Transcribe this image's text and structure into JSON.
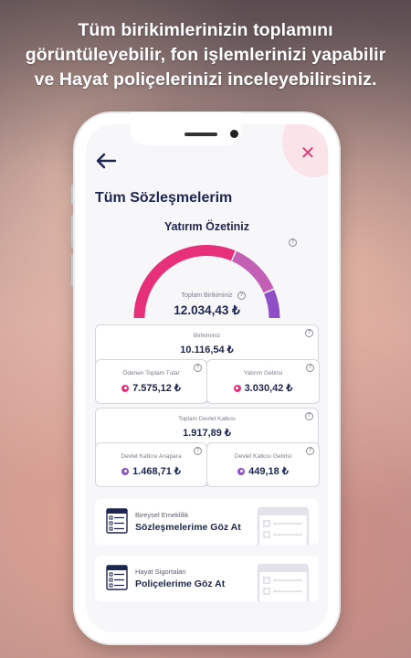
{
  "headline": {
    "line1": "Tüm birikimlerinizin toplamını",
    "line2": "görüntüleyebilir, fon işlemlerinizi yapabilir",
    "line3": "ve Hayat poliçelerinizi inceleyebilirsiniz."
  },
  "app": {
    "title": "Tüm Sözleşmelerim",
    "summary_title": "Yatırım Özetiniz",
    "total_label": "Toplam Birikiminiz",
    "total_value": "12.034,43 ₺",
    "gauge_fractions": {
      "pink": 0.63,
      "purple_light": 0.24,
      "purple": 0.13
    }
  },
  "savings": {
    "label": "Birikiminiz",
    "value": "10.116,54 ₺",
    "paid_label": "Ödenen Toplam Tutar",
    "paid_value": "7.575,12 ₺",
    "return_label": "Yatırım Getirisi",
    "return_value": "3.030,42 ₺"
  },
  "state": {
    "label": "Toplam Devlet Katkısı",
    "value": "1.917,89 ₺",
    "principal_label": "Devlet Katkısı Anapara",
    "principal_value": "1.468,71 ₺",
    "return_label": "Devlet Katkısı Getirisi",
    "return_value": "449,18 ₺"
  },
  "links": {
    "pension_small": "Bireysel Emeklilik",
    "pension_big": "Sözleşmelerime Göz At",
    "life_small": "Hayat Sigortaları",
    "life_big": "Poliçelerime Göz At"
  },
  "colors": {
    "pink": "#e8307a",
    "purple_light": "#c35fb5",
    "purple": "#8e4ec6",
    "navy": "#1d2550"
  }
}
